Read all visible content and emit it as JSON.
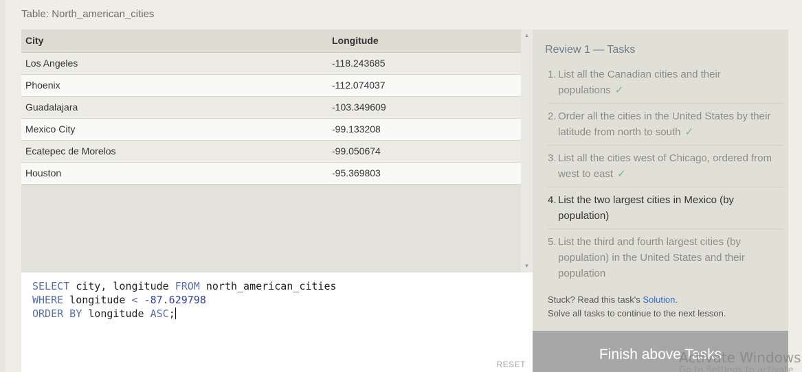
{
  "table_title": "Table: North_american_cities",
  "results": {
    "columns": [
      "City",
      "Longitude"
    ],
    "rows": [
      [
        "Los Angeles",
        "-118.243685"
      ],
      [
        "Phoenix",
        "-112.074037"
      ],
      [
        "Guadalajara",
        "-103.349609"
      ],
      [
        "Mexico City",
        "-99.133208"
      ],
      [
        "Ecatepec de Morelos",
        "-99.050674"
      ],
      [
        "Houston",
        "-95.369803"
      ]
    ]
  },
  "editor": {
    "line1": {
      "kw1": "SELECT",
      "t1": " city, longitude ",
      "kw2": "FROM",
      "t2": " north_american_cities"
    },
    "line2": {
      "kw1": "WHERE",
      "t1": " longitude ",
      "op": "<",
      "t2": " ",
      "num": "-87.629798"
    },
    "line3": {
      "kw1": "ORDER BY",
      "t1": " longitude ",
      "kw2": "ASC",
      "t2": ";"
    },
    "reset_label": "RESET"
  },
  "tasks": {
    "heading": "Review 1 — Tasks",
    "items": [
      {
        "num": "1.",
        "text": "List all the Canadian cities and their populations",
        "done": "✓"
      },
      {
        "num": "2.",
        "text": "Order all the cities in the United States by their latitude from north to south",
        "done": "✓"
      },
      {
        "num": "3.",
        "text": "List all the cities west of Chicago, ordered from west to east",
        "done": "✓"
      },
      {
        "num": "4.",
        "text": "List the two largest cities in Mexico (by population)",
        "done": ""
      },
      {
        "num": "5.",
        "text": "List the third and fourth largest cities (by population) in the United States and their population",
        "done": ""
      }
    ],
    "stuck_prefix": "Stuck? Read this task's ",
    "solution_link": "Solution",
    "stuck_suffix": ".",
    "continue_note": "Solve all tasks to continue to the next lesson."
  },
  "finish_button": "Finish above Tasks",
  "watermark": {
    "title": "Activate Windows",
    "subtitle": "Go to Settings to activate Windows."
  }
}
